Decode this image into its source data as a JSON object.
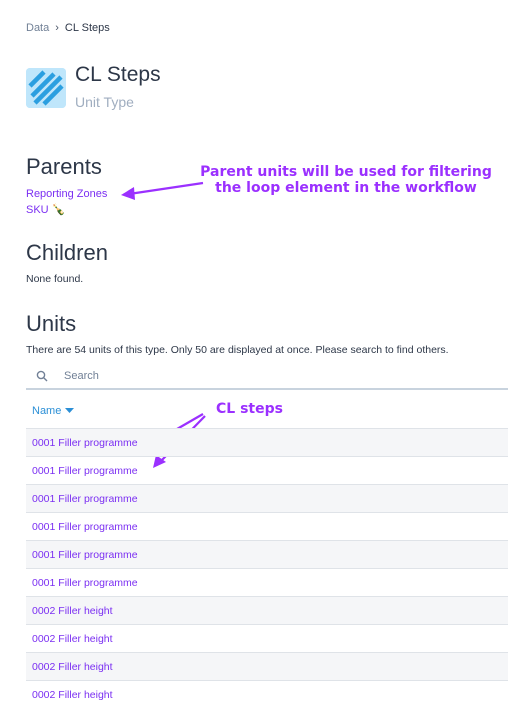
{
  "breadcrumb": {
    "root": "Data",
    "current": "CL Steps"
  },
  "header": {
    "title": "CL Steps",
    "subtitle": "Unit Type",
    "icon": "striped-square-icon"
  },
  "parents": {
    "heading": "Parents",
    "items": [
      "Reporting Zones",
      "SKU 🍾"
    ]
  },
  "children": {
    "heading": "Children",
    "empty_text": "None found."
  },
  "units": {
    "heading": "Units",
    "info": "There are 54 units of this type. Only 50 are displayed at once. Please search to find others.",
    "search_placeholder": "Search",
    "column_header": "Name",
    "rows": [
      "0001 Filler programme",
      "0001 Filler programme",
      "0001 Filler programme",
      "0001 Filler programme",
      "0001 Filler programme",
      "0001 Filler programme",
      "0002 Filler height",
      "0002 Filler height",
      "0002 Filler height",
      "0002 Filler height"
    ]
  },
  "annotations": {
    "parents_note_line1": "Parent units will be used for filtering",
    "parents_note_line2": "the loop element in the workflow",
    "steps_note": "CL steps"
  },
  "colors": {
    "link": "#7b2ff2",
    "annotation": "#9b30ff",
    "sort_header": "#2b8fd6",
    "icon_bg": "#bfe6fb",
    "icon_stripe": "#2b9fe0"
  }
}
